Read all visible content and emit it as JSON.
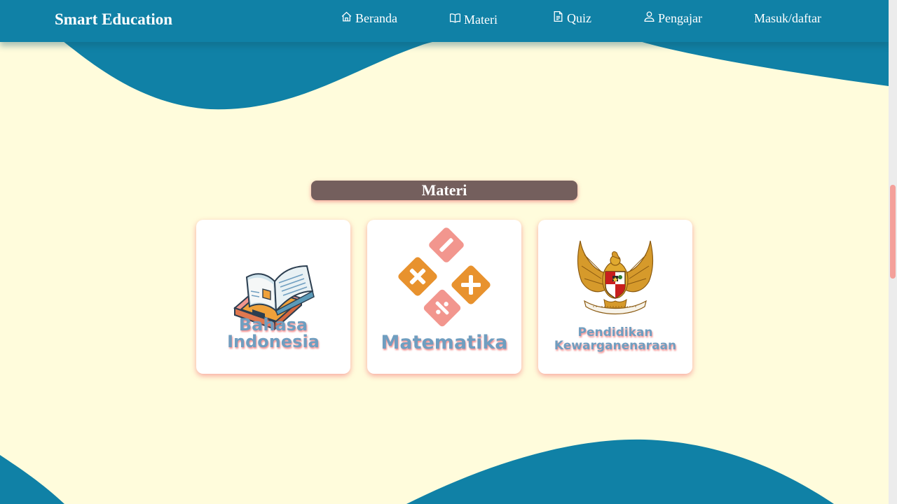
{
  "navbar": {
    "brand": "Smart Education",
    "items": [
      {
        "label": "Beranda",
        "icon": "home-icon"
      },
      {
        "label": "Materi",
        "icon": "book-icon"
      },
      {
        "label": "Quiz",
        "icon": "document-icon"
      },
      {
        "label": "Pengajar",
        "icon": "user-icon"
      },
      {
        "label": "Masuk/daftar"
      }
    ]
  },
  "section": {
    "title": "Materi"
  },
  "cards": [
    {
      "line1": "Bahasa",
      "line2": "Indonesia",
      "icon": "books-icon"
    },
    {
      "line1": "Matematika",
      "icon": "math-operators-icon"
    },
    {
      "line1": "Pendidikan",
      "line2": "Kewarganenaraan",
      "icon": "garuda-emblem-icon"
    }
  ],
  "colors": {
    "navbar": "#1081a6",
    "background": "#fffcdc",
    "title_bg": "#745f5d",
    "card_label": "#6f9ec0",
    "accent_shadow": "#f08080"
  }
}
